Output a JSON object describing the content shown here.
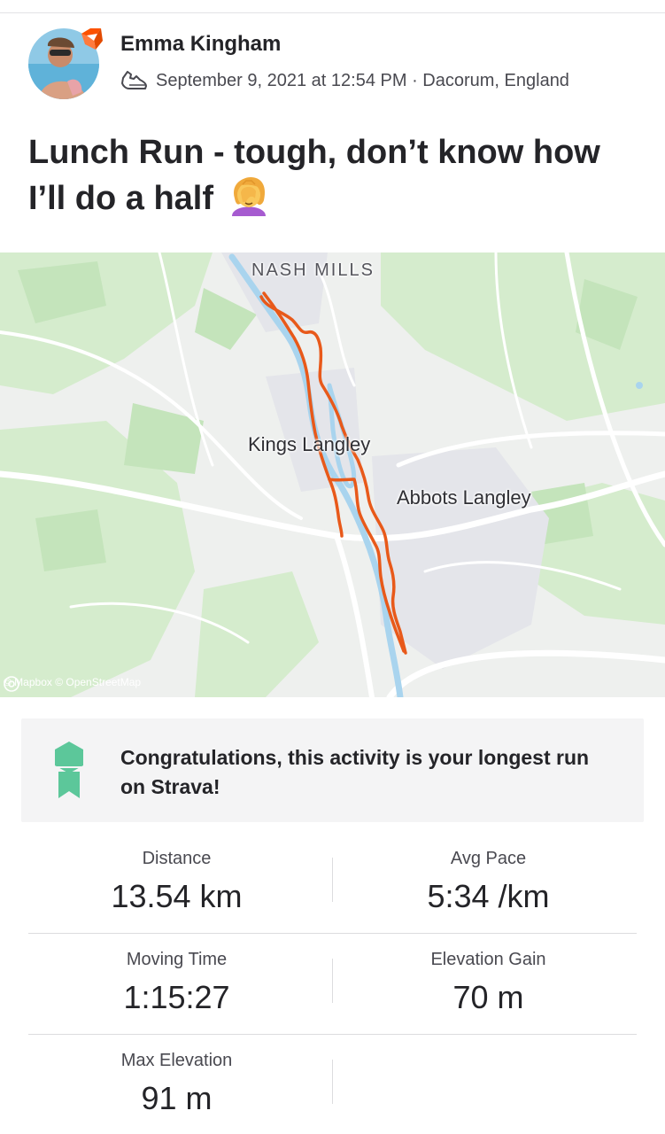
{
  "athlete": {
    "name": "Emma Kingham",
    "meta": "September 9, 2021 at 12:54 PM · Dacorum, England"
  },
  "activity": {
    "title": "Lunch Run - tough, don’t know how I’ll do a half",
    "title_emoji": "woman-facepalming-emoji"
  },
  "map": {
    "labels": {
      "nash_mills": "NASH MILLS",
      "kings_langley": "Kings Langley",
      "abbots_langley": "Abbots Langley"
    },
    "attribution": "© Mapbox © OpenStreetMap",
    "route_color": "#e8591a",
    "water_color": "#a9d4ee",
    "park_color": "#cfe8c9"
  },
  "achievement": {
    "text": "Congratulations, this activity is your longest run on Strava!",
    "icon": "medal-icon",
    "icon_color": "#5cc79a"
  },
  "stats": [
    {
      "left": {
        "label": "Distance",
        "value": "13.54 km"
      },
      "right": {
        "label": "Avg Pace",
        "value": "5:34 /km"
      }
    },
    {
      "left": {
        "label": "Moving Time",
        "value": "1:15:27"
      },
      "right": {
        "label": "Elevation Gain",
        "value": "70 m"
      }
    },
    {
      "left": {
        "label": "Max Elevation",
        "value": "91 m"
      },
      "right": {
        "label": "",
        "value": ""
      }
    }
  ],
  "colors": {
    "brand": "#fc5200",
    "text": "#242428",
    "muted": "#494950"
  }
}
